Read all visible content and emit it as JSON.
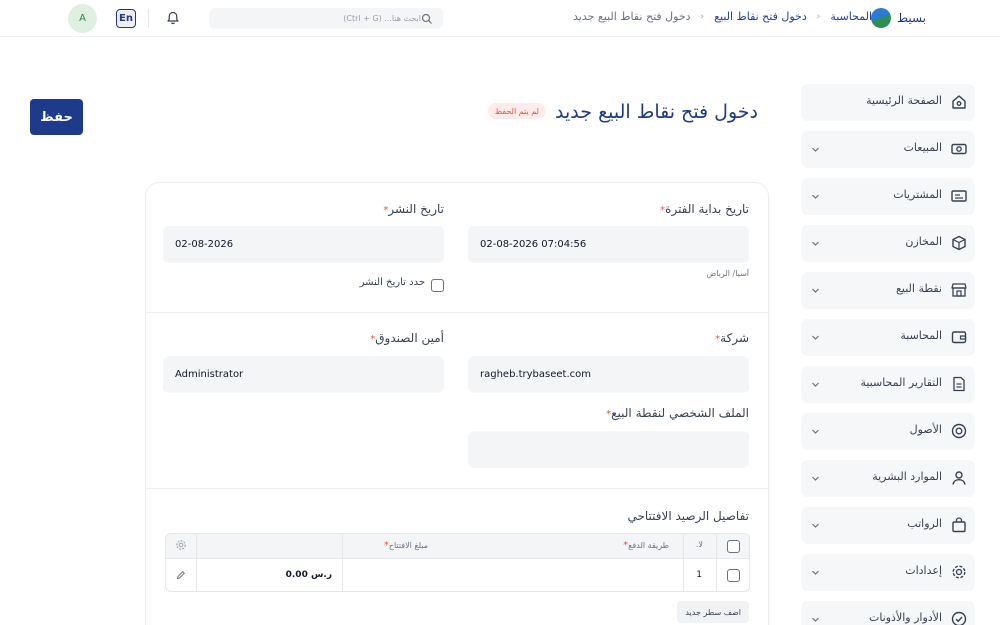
{
  "header": {
    "brand_name": "بسيط",
    "breadcrumbs": [
      "المحاسبة",
      "دخول فتح نقاط البيع",
      "دخول فتح نقاط البيع جديد"
    ],
    "search_placeholder": "ابحث هنا... (Ctrl + G)",
    "language_label": "En",
    "avatar_initial": "A"
  },
  "sidebar": {
    "items": [
      {
        "label": "الصفحة الرئيسية",
        "icon": "home-icon"
      },
      {
        "label": "المبيعات",
        "icon": "money-icon"
      },
      {
        "label": "المشتريات",
        "icon": "receipt-icon"
      },
      {
        "label": "المخازن",
        "icon": "box-icon"
      },
      {
        "label": "نقطة البيع",
        "icon": "store-icon"
      },
      {
        "label": "المحاسبة",
        "icon": "wallet-icon"
      },
      {
        "label": "التقارير المحاسبية",
        "icon": "report-icon"
      },
      {
        "label": "الأصول",
        "icon": "asset-icon"
      },
      {
        "label": "الموارد البشرية",
        "icon": "person-icon"
      },
      {
        "label": "الرواتب",
        "icon": "bag-icon"
      },
      {
        "label": "إعدادات",
        "icon": "gear-icon"
      },
      {
        "label": "الأدوار والأذونات",
        "icon": "check-badge-icon"
      }
    ]
  },
  "page": {
    "title": "دخول فتح نقاط البيع جديد",
    "status": "لم يتم الحفظ",
    "save_label": "حفظ"
  },
  "form": {
    "period_start": {
      "label": "تاريخ بداية الفترة",
      "value": "02-08-2026 07:04:56",
      "timezone": "آسيا/ الرياض"
    },
    "posting_date": {
      "label": "تاريخ النشر",
      "value": "02-08-2026",
      "checkbox_label": "حدد تاريخ النشر"
    },
    "company": {
      "label": "شركة",
      "value": "ragheb.trybaseet.com"
    },
    "cashier": {
      "label": "أمين الصندوق",
      "value": "Administrator"
    },
    "pos_profile": {
      "label": "الملف الشخصي لنقطة البيع",
      "value": ""
    }
  },
  "opening_balance": {
    "title": "تفاصيل الرصيد الافتتاحي",
    "columns": {
      "no": "لا.",
      "payment_method": "طريقة الدفع",
      "amount": "مبلغ الافتتاح"
    },
    "rows": [
      {
        "no": "1",
        "payment_method": "",
        "amount": "ر.س 0.00"
      }
    ],
    "add_row_label": "اضف سطر جديد"
  },
  "colors": {
    "primary": "#1e3a8a",
    "required": "#e25544",
    "badge_bg": "#fdecea"
  }
}
